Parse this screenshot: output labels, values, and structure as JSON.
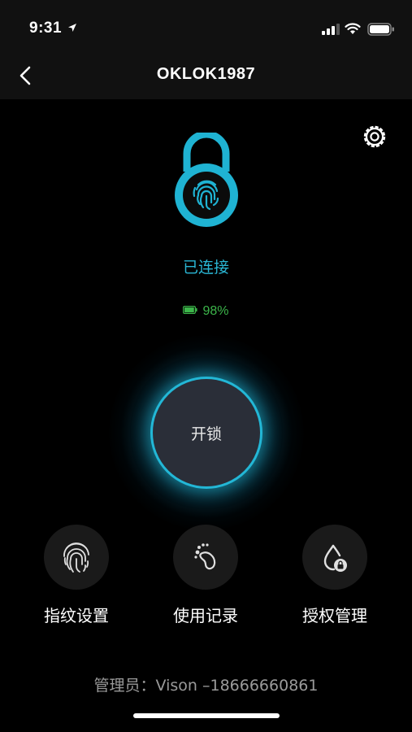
{
  "status_bar": {
    "time": "9:31",
    "icons": [
      "location-arrow-icon",
      "signal-icon",
      "wifi-icon",
      "battery-icon"
    ]
  },
  "nav": {
    "title": "OKLOK1987",
    "back_icon": "chevron-left-icon"
  },
  "settings_icon": "gear-icon",
  "lock": {
    "icon": "fingerprint-padlock-icon",
    "status": "已连接",
    "battery": {
      "text": "98%",
      "level": 0.98,
      "color": "#3cb54a"
    }
  },
  "unlock_button": {
    "label": "开锁",
    "accent": "#23b7d6"
  },
  "functions": [
    {
      "label": "指纹设置",
      "icon": "fingerprint-icon"
    },
    {
      "label": "使用记录",
      "icon": "footprint-icon"
    },
    {
      "label": "授权管理",
      "icon": "droplet-lock-icon"
    }
  ],
  "admin_info": "管理员：Vison –18666660861",
  "colors": {
    "accent": "#23b7d6",
    "background": "#000000",
    "bar": "#111111"
  }
}
